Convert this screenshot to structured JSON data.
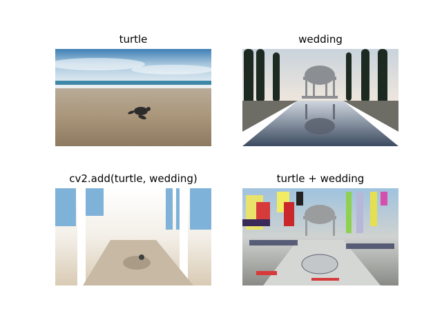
{
  "figure": {
    "panels": [
      {
        "title": "turtle"
      },
      {
        "title": "wedding"
      },
      {
        "title": "cv2.add(turtle, wedding)"
      },
      {
        "title": "turtle + wedding"
      }
    ]
  }
}
